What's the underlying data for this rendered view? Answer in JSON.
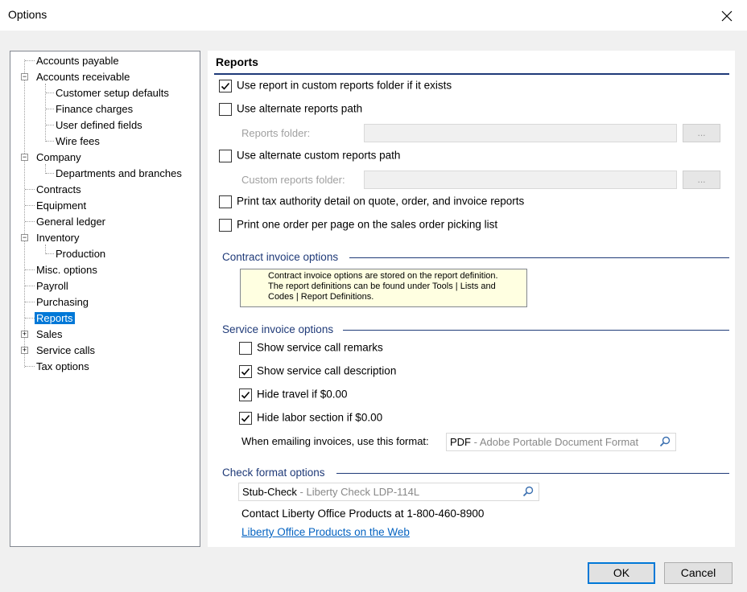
{
  "window": {
    "title": "Options",
    "close_glyph": "✕"
  },
  "tree": {
    "items": [
      {
        "label": "Accounts payable"
      },
      {
        "label": "Accounts receivable",
        "expander": "−"
      },
      {
        "label": "Customer setup defaults"
      },
      {
        "label": "Finance charges"
      },
      {
        "label": "User defined fields"
      },
      {
        "label": "Wire fees"
      },
      {
        "label": "Company",
        "expander": "−"
      },
      {
        "label": "Departments and branches"
      },
      {
        "label": "Contracts"
      },
      {
        "label": "Equipment"
      },
      {
        "label": "General ledger"
      },
      {
        "label": "Inventory",
        "expander": "−"
      },
      {
        "label": "Production"
      },
      {
        "label": "Misc. options"
      },
      {
        "label": "Payroll"
      },
      {
        "label": "Purchasing"
      },
      {
        "label": "Reports",
        "selected": true
      },
      {
        "label": "Sales",
        "expander": "+"
      },
      {
        "label": "Service calls",
        "expander": "+"
      },
      {
        "label": "Tax options"
      }
    ]
  },
  "panel": {
    "heading": "Reports",
    "options": [
      {
        "label": "Use report in custom reports folder if it exists",
        "checked": true
      },
      {
        "label": "Use alternate reports path",
        "checked": false
      },
      {
        "label": "Use alternate custom reports path",
        "checked": false
      },
      {
        "label": "Print tax authority detail on quote, order, and invoice reports",
        "checked": false
      },
      {
        "label": "Print one order per page on the sales order picking list",
        "checked": false
      }
    ],
    "reports_folder_label": "Reports folder:",
    "custom_reports_folder_label": "Custom reports folder:",
    "browse_label": "...",
    "contract_section": {
      "title": "Contract invoice options",
      "note_lines": [
        "Contract invoice options are stored on the report definition.",
        "The report definitions can be found under Tools | Lists and",
        "Codes | Report Definitions."
      ]
    },
    "service_section": {
      "title": "Service invoice options",
      "options": [
        {
          "label": "Show service call remarks",
          "checked": false
        },
        {
          "label": "Show service call description",
          "checked": true
        },
        {
          "label": "Hide travel if $0.00",
          "checked": true
        },
        {
          "label": "Hide labor section if $0.00",
          "checked": true
        }
      ],
      "email_format_label": "When emailing invoices, use this format:",
      "email_format_code": "PDF",
      "email_format_desc": " - Adobe Portable Document Format"
    },
    "check_section": {
      "title": "Check format options",
      "format_code": "Stub-Check",
      "format_desc": " - Liberty Check LDP-114L",
      "contact_text": "Contact Liberty Office Products at 1-800-460-8900",
      "link_text": "Liberty Office Products on the Web"
    }
  },
  "buttons": {
    "ok": "OK",
    "cancel": "Cancel"
  },
  "colors": {
    "accent": "#0078d7",
    "section": "#1f3a78",
    "link": "#0563c1",
    "note_bg": "#ffffe1"
  },
  "icons": {
    "close": "close-icon",
    "lookup": "search-icon",
    "check": "checkmark-icon"
  }
}
